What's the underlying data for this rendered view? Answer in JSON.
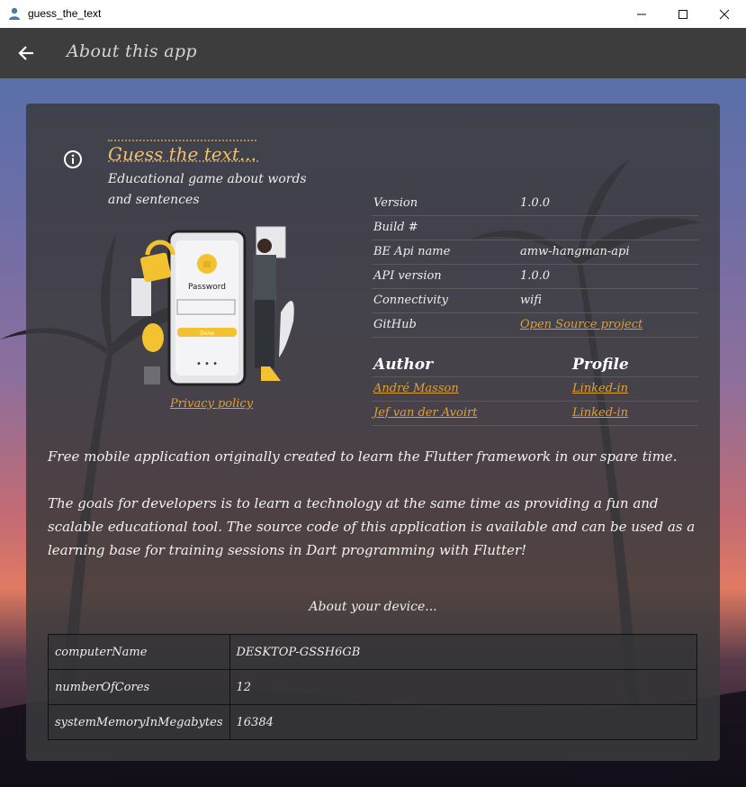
{
  "window": {
    "title": "guess_the_text"
  },
  "appbar": {
    "title": "About this app"
  },
  "app": {
    "name": "Guess the text...",
    "description": "Educational game about words and sentences",
    "illustration_text": "Password",
    "illustration_button": "Done",
    "privacy_link": "Privacy policy"
  },
  "info": [
    {
      "key": "Version",
      "value": "1.0.0",
      "link": false
    },
    {
      "key": "Build #",
      "value": "",
      "link": false
    },
    {
      "key": "BE Api name",
      "value": "amw-hangman-api",
      "link": false
    },
    {
      "key": "API version",
      "value": "1.0.0",
      "link": false
    },
    {
      "key": "Connectivity",
      "value": "wifi",
      "link": false
    },
    {
      "key": "GitHub",
      "value": "Open Source project",
      "link": true
    }
  ],
  "authors": {
    "header_author": "Author",
    "header_profile": "Profile",
    "rows": [
      {
        "name": "André Masson",
        "profile": "Linked-in"
      },
      {
        "name": "Jef van der Avoirt",
        "profile": "Linked-in"
      }
    ]
  },
  "paragraphs": {
    "p1": "Free mobile application originally created to learn the Flutter framework in our spare time.",
    "p2": "The goals for developers is to learn a technology at the same time as providing a fun and scalable educational tool. The source code of this application is available and can be used as a learning base for training sessions in Dart programming with Flutter!"
  },
  "device": {
    "title": "About your device...",
    "rows": [
      {
        "key": "computerName",
        "value": "DESKTOP-GSSH6GB"
      },
      {
        "key": "numberOfCores",
        "value": "12"
      },
      {
        "key": "systemMemoryInMegabytes",
        "value": "16384"
      }
    ]
  },
  "colors": {
    "accent": "#e0a030",
    "appbar": "#3d3d3d",
    "card": "#3a3a3c"
  }
}
